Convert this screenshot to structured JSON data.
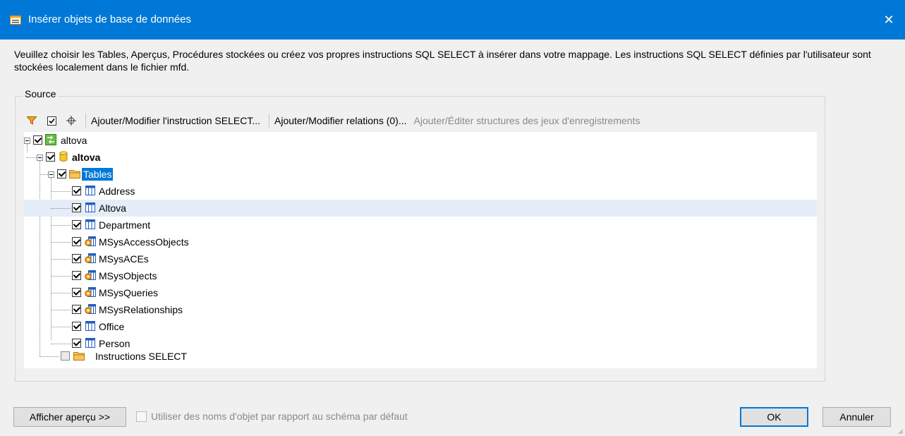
{
  "window": {
    "title": "Insérer objets de base de données",
    "close_glyph": "✕"
  },
  "description": "Veuillez choisir les Tables, Aperçus, Procédures stockées ou créez vos propres instructions SQL SELECT à insérer dans votre mappage. Les instructions SQL SELECT définies par l'utilisateur sont stockées localement dans le fichier mfd.",
  "source_group": {
    "label": "Source"
  },
  "toolbar": {
    "filter_icon": "filter-icon",
    "checked_items_icon": "checkbox-icon",
    "locate_icon": "crosshair-icon",
    "add_select": "Ajouter/Modifier l'instruction SELECT...",
    "add_relations": "Ajouter/Modifier relations (0)...",
    "add_recordsets": "Ajouter/Éditer structures des jeux d'enregistrements"
  },
  "tree": {
    "root": {
      "label": "altova",
      "icon": "connection-icon",
      "checked": true
    },
    "database": {
      "label": "altova",
      "icon": "database-icon",
      "checked": true
    },
    "tables_folder": {
      "label": "Tables",
      "icon": "folder-icon",
      "checked": true,
      "selected": true
    },
    "tables": [
      {
        "label": "Address",
        "icon": "table-icon",
        "checked": true
      },
      {
        "label": "Altova",
        "icon": "table-icon",
        "checked": true,
        "highlighted": true
      },
      {
        "label": "Department",
        "icon": "table-icon",
        "checked": true
      },
      {
        "label": "MSysAccessObjects",
        "icon": "system-table-icon",
        "checked": true
      },
      {
        "label": "MSysACEs",
        "icon": "system-table-icon",
        "checked": true
      },
      {
        "label": "MSysObjects",
        "icon": "system-table-icon",
        "checked": true
      },
      {
        "label": "MSysQueries",
        "icon": "system-table-icon",
        "checked": true
      },
      {
        "label": "MSysRelationships",
        "icon": "system-table-icon",
        "checked": true
      },
      {
        "label": "Office",
        "icon": "table-icon",
        "checked": true
      },
      {
        "label": "Person",
        "icon": "table-icon",
        "checked": true
      }
    ],
    "select_folder": {
      "label": "Instructions SELECT",
      "icon": "folder-icon",
      "checked": false
    }
  },
  "footer": {
    "preview_button": "Afficher aperçu >>",
    "default_schema_option": "Utiliser des noms d'objet par rapport au schéma par défaut",
    "ok": "OK",
    "cancel": "Annuler"
  },
  "colors": {
    "titlebar": "#0078d7",
    "selection": "#0078d7",
    "highlight_row": "#e5edf8"
  }
}
